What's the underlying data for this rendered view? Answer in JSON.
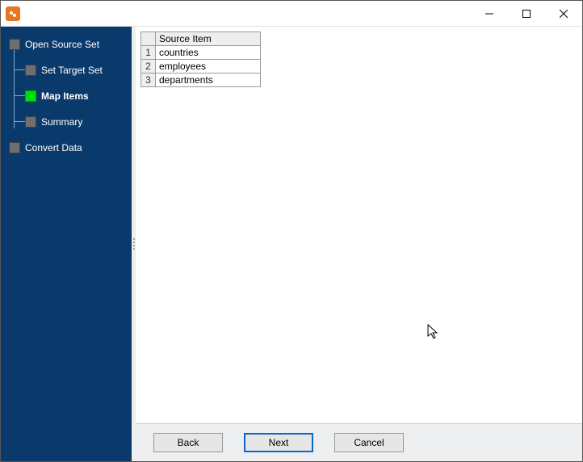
{
  "window": {
    "title": ""
  },
  "sidebar": {
    "items": [
      {
        "label": "Open Source Set",
        "active": false,
        "child": false
      },
      {
        "label": "Set Target Set",
        "active": false,
        "child": true
      },
      {
        "label": "Map Items",
        "active": true,
        "child": true
      },
      {
        "label": "Summary",
        "active": false,
        "child": true
      },
      {
        "label": "Convert Data",
        "active": false,
        "child": false
      }
    ]
  },
  "table": {
    "column_header": "Source Item",
    "rows": [
      {
        "n": "1",
        "value": "countries"
      },
      {
        "n": "2",
        "value": "employees"
      },
      {
        "n": "3",
        "value": "departments"
      }
    ]
  },
  "buttons": {
    "back": "Back",
    "next": "Next",
    "cancel": "Cancel"
  }
}
